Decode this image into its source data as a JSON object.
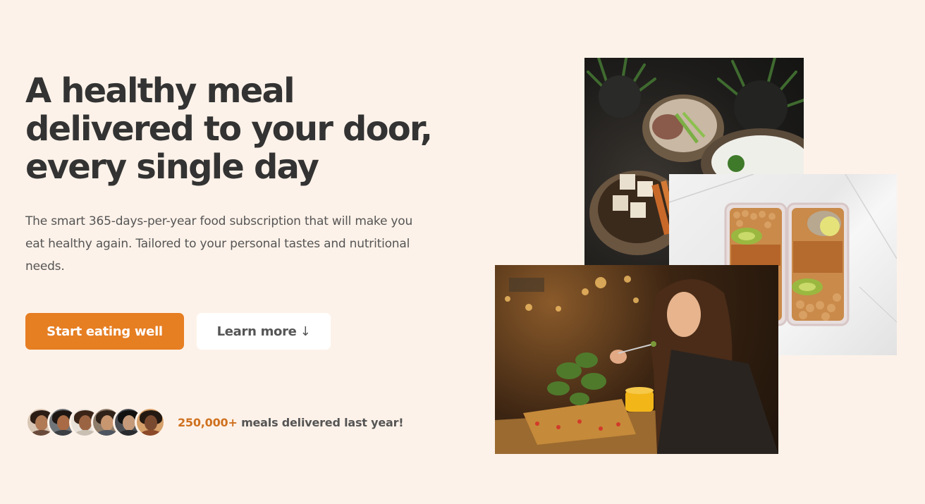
{
  "hero": {
    "title": "A healthy meal delivered to your door, every single day",
    "description": "The smart 365-days-per-year food subscription that will make you eat healthy again. Tailored to your personal tastes and nutritional needs.",
    "cta_primary": "Start eating well",
    "cta_secondary": "Learn more",
    "cta_secondary_icon": "↓"
  },
  "delivered": {
    "count": "250,000+",
    "text": "meals delivered last year!"
  },
  "avatars": [
    {
      "name": "customer-avatar-1"
    },
    {
      "name": "customer-avatar-2"
    },
    {
      "name": "customer-avatar-3"
    },
    {
      "name": "customer-avatar-4"
    },
    {
      "name": "customer-avatar-5"
    },
    {
      "name": "customer-avatar-6"
    }
  ],
  "colors": {
    "background": "#fdf2e9",
    "primary": "#e67e22",
    "primary_dark": "#cf711f",
    "text": "#333333"
  }
}
